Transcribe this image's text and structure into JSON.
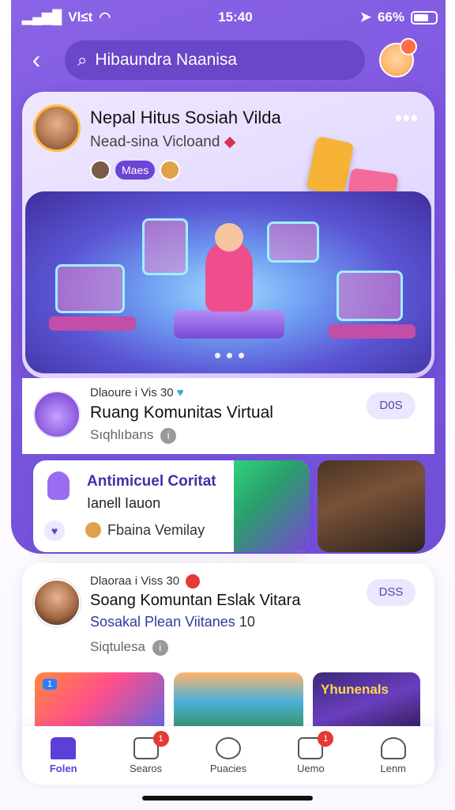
{
  "status_bar": {
    "carrier": "Vl≤t",
    "time": "15:40",
    "battery": "66%"
  },
  "search": {
    "placeholder": "Hibaundra Naanisa"
  },
  "feature": {
    "title": "Nepal Hitus Sosiah Vilda",
    "subtitle": "Nead-sina Vicloand",
    "chip_label": "Maes",
    "more": "•••"
  },
  "row_card": {
    "meta": "Dlaoure i Vis 30",
    "title": "Ruang Komunitas Virtual",
    "subtitle": "Sıqhlıbans",
    "button": "D0S"
  },
  "community_card": {
    "title": "Antimicuel Coritat",
    "subtitle": "Ianell Iauon",
    "footer": "Fbaina Vemilay"
  },
  "post_card": {
    "meta": "Dlaoraa i Viss 30",
    "title": "Soang Komuntan Eslak Vitara",
    "subtitle": "Sosakal Plean Viitanes",
    "subtitle_num": "10",
    "footer": "Siqtulesa",
    "button": "DSS",
    "thumb_label": "Yhunenals",
    "thumb_tag": "1"
  },
  "nav": [
    {
      "label": "Folen",
      "active": true,
      "badge": ""
    },
    {
      "label": "Searos",
      "active": false,
      "badge": "1"
    },
    {
      "label": "Puacies",
      "active": false,
      "badge": ""
    },
    {
      "label": "Uemo",
      "active": false,
      "badge": "1"
    },
    {
      "label": "Lenm",
      "active": false,
      "badge": ""
    }
  ],
  "colors": {
    "accent": "#6f4fd6",
    "brand_light": "#ebe7ff",
    "badge": "#e53935"
  }
}
